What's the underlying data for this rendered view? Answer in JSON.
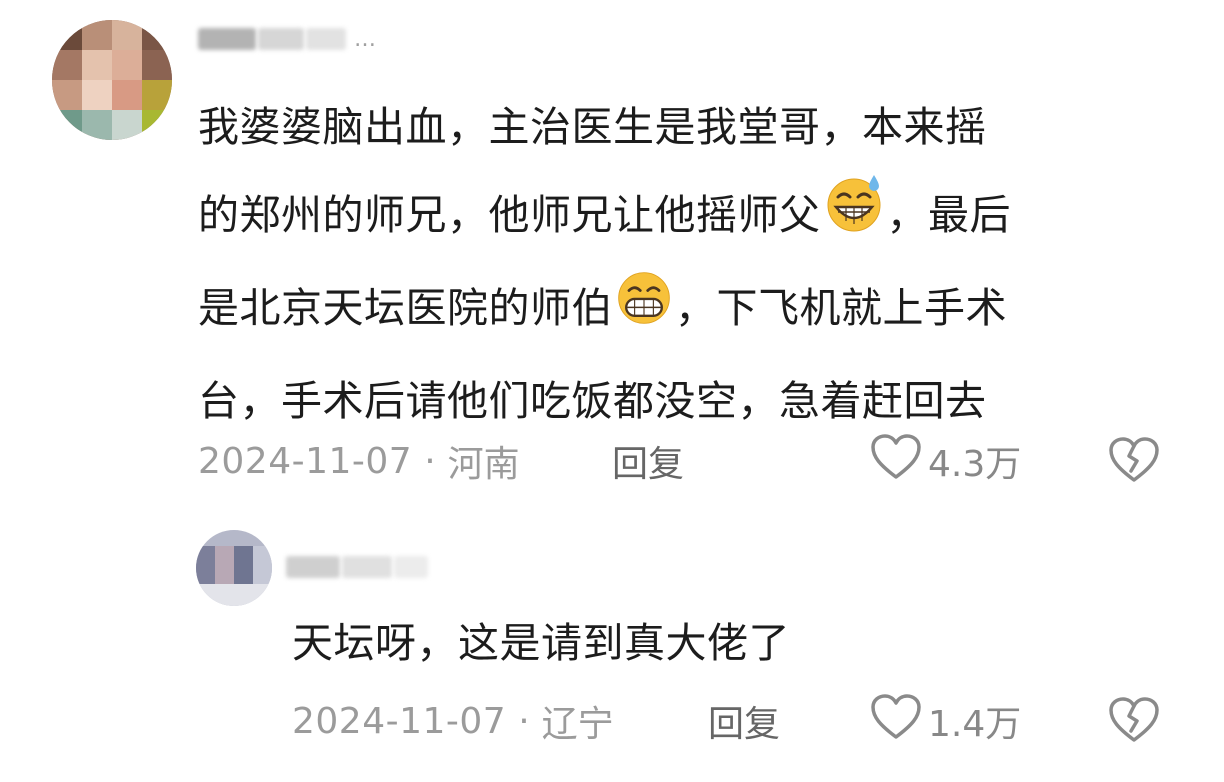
{
  "comments": [
    {
      "username_visible": "素芸",
      "body_lines": [
        "我婆婆脑出血，主治医生是我堂哥，本来摇",
        "的郑州的师兄，他师兄让他摇师父",
        "，最后",
        "是北京天坛医院的师伯",
        "，下飞机就上手术",
        "台，手术后请他们吃饭都没空，急着赶回去"
      ],
      "date": "2024-11-07",
      "location": "河南",
      "reply_label": "回复",
      "like_count": "4.3万",
      "emojis": [
        "grinning-sweat-emoji",
        "grinning-teeth-emoji"
      ]
    },
    {
      "body": "天坛呀，这是请到真大佬了",
      "date": "2024-11-07",
      "location": "辽宁",
      "reply_label": "回复",
      "like_count": "1.4万"
    }
  ],
  "meta_separator": "·",
  "colors": {
    "text": "#1c1c1c",
    "meta": "#9b9b9b",
    "reply": "#666666",
    "icon": "#8a8a8a",
    "emoji_face": "#f7c13a"
  },
  "icons": [
    "heart-outline-icon",
    "broken-heart-icon"
  ]
}
